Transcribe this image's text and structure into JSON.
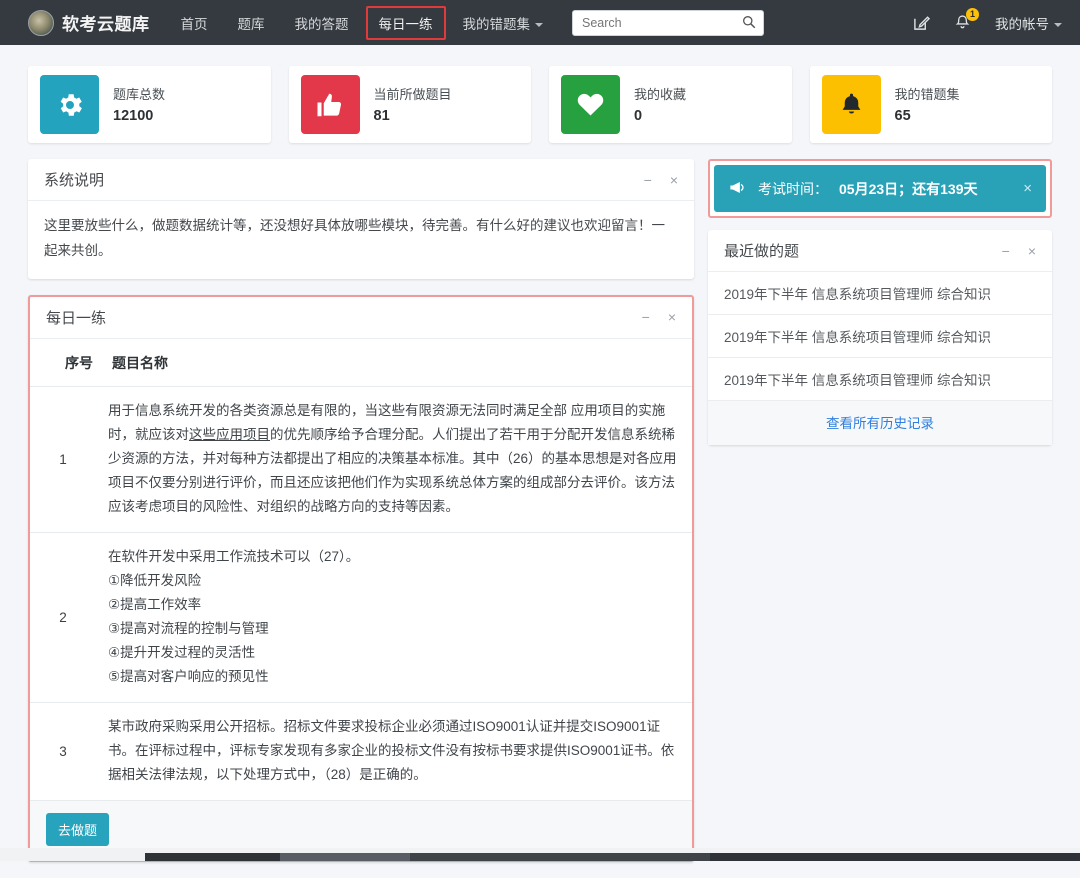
{
  "navbar": {
    "brand": "软考云题库",
    "links": [
      {
        "label": "首页",
        "active": false,
        "highlighted": false
      },
      {
        "label": "题库",
        "active": false,
        "highlighted": false
      },
      {
        "label": "我的答题",
        "active": false,
        "highlighted": false
      },
      {
        "label": "每日一练",
        "active": true,
        "highlighted": true
      },
      {
        "label": "我的错题集",
        "active": false,
        "highlighted": false,
        "caret": true
      }
    ],
    "search": {
      "value": "",
      "placeholder": "Search",
      "icon": "search-icon"
    },
    "compose_icon": "compose-icon",
    "notification_icon": "bell-icon",
    "notification_count": "1",
    "account_label": "我的帐号"
  },
  "stats": [
    {
      "label": "题库总数",
      "value": "12100",
      "icon": "gear-icon",
      "color": "#23a3bd"
    },
    {
      "label": "当前所做题目",
      "value": "81",
      "icon": "thumbs-up-icon",
      "color": "#e2384a"
    },
    {
      "label": "我的收藏",
      "value": "0",
      "icon": "heart-icon",
      "color": "#27a03f"
    },
    {
      "label": "我的错题集",
      "value": "65",
      "icon": "bell-icon",
      "color": "#fcc000"
    }
  ],
  "system_note": {
    "title": "系统说明",
    "minimize_label": "−",
    "close_label": "×",
    "body": "这里要放些什么，做题数据统计等，还没想好具体放哪些模块，待完善。有什么好的建议也欢迎留言！一起来共创。"
  },
  "daily_practice": {
    "title": "每日一练",
    "minimize_label": "−",
    "close_label": "×",
    "columns": [
      "序号",
      "题目名称"
    ],
    "rows": [
      {
        "no": "1",
        "text_before": "用于信息系统开发的各类资源总是有限的，当这些有限资源无法同时满足全部 应用项目的实施时，就应该对",
        "text_underline": "这些应用项目",
        "text_after": "的优先顺序给予合理分配。人们提出了若干用于分配开发信息系统稀少资源的方法，并对每种方法都提出了相应的决策基本标准。其中（26）的基本思想是对各应用项目不仅要分别进行评价，而且还应该把他们作为实现系统总体方案的组成部分去评价。该方法应该考虑项目的风险性、对组织的战略方向的支持等因素。"
      },
      {
        "no": "2",
        "text": "在软件开发中采用工作流技术可以（27）。\n①降低开发风险\n②提高工作效率\n③提高对流程的控制与管理\n④提升开发过程的灵活性\n⑤提高对客户响应的预见性"
      },
      {
        "no": "3",
        "text": "某市政府采购采用公开招标。招标文件要求投标企业必须通过ISO9001认证并提交ISO9001证书。在评标过程中，评标专家发现有多家企业的投标文件没有按标书要求提供ISO9001证书。依据相关法律法规，以下处理方式中，（28）是正确的。"
      }
    ],
    "action_button": "去做题"
  },
  "exam_alert": {
    "icon": "megaphone-icon",
    "label": "考试时间：",
    "date": "05月23日；还有139天",
    "close_label": "×",
    "color": "#29a2b8"
  },
  "recent": {
    "title": "最近做的题",
    "minimize_label": "−",
    "close_label": "×",
    "items": [
      "2019年下半年 信息系统项目管理师 综合知识",
      "2019年下半年 信息系统项目管理师 综合知识",
      "2019年下半年 信息系统项目管理师 综合知识"
    ],
    "more_label": "查看所有历史记录"
  }
}
